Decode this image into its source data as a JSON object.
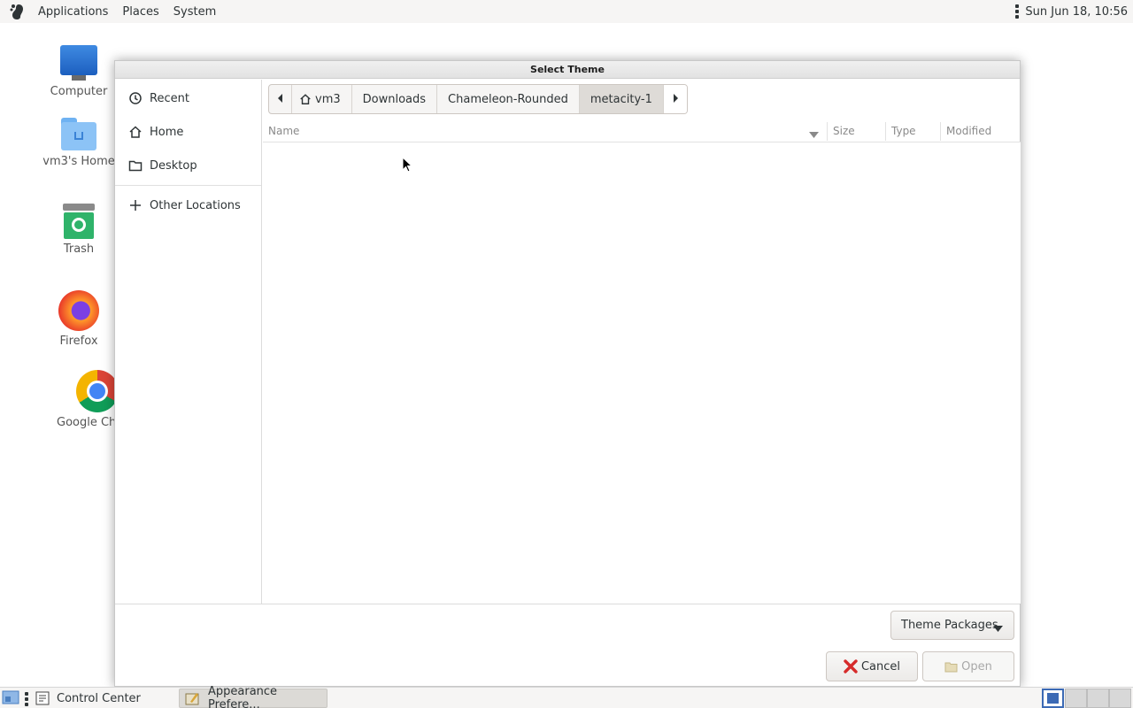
{
  "top_panel": {
    "menus": [
      "Applications",
      "Places",
      "System"
    ],
    "clock": "Sun Jun 18, 10:56"
  },
  "desktop": {
    "icons": [
      {
        "label": "Computer",
        "icon": "computer-icon"
      },
      {
        "label": "vm3's Home",
        "icon": "home-folder-icon"
      },
      {
        "label": "Trash",
        "icon": "trash-icon"
      },
      {
        "label": "Firefox",
        "icon": "firefox-icon"
      },
      {
        "label": "Google Ch",
        "icon": "chrome-icon"
      }
    ]
  },
  "dialog": {
    "title": "Select Theme",
    "sidebar": {
      "items": [
        {
          "label": "Recent",
          "icon": "clock-icon"
        },
        {
          "label": "Home",
          "icon": "home-icon"
        },
        {
          "label": "Desktop",
          "icon": "folder-icon"
        }
      ],
      "other_locations": "Other Locations"
    },
    "pathbar": {
      "segments": [
        "vm3",
        "Downloads",
        "Chameleon-Rounded",
        "metacity-1"
      ],
      "active": "metacity-1"
    },
    "columns": [
      "Name",
      "Size",
      "Type",
      "Modified"
    ],
    "filter_label": "Theme Packages",
    "cancel_label": "Cancel",
    "open_label": "Open"
  },
  "taskbar": {
    "items": [
      {
        "label": "Control Center",
        "active": false
      },
      {
        "label": "Appearance Prefere...",
        "active": true
      }
    ]
  }
}
